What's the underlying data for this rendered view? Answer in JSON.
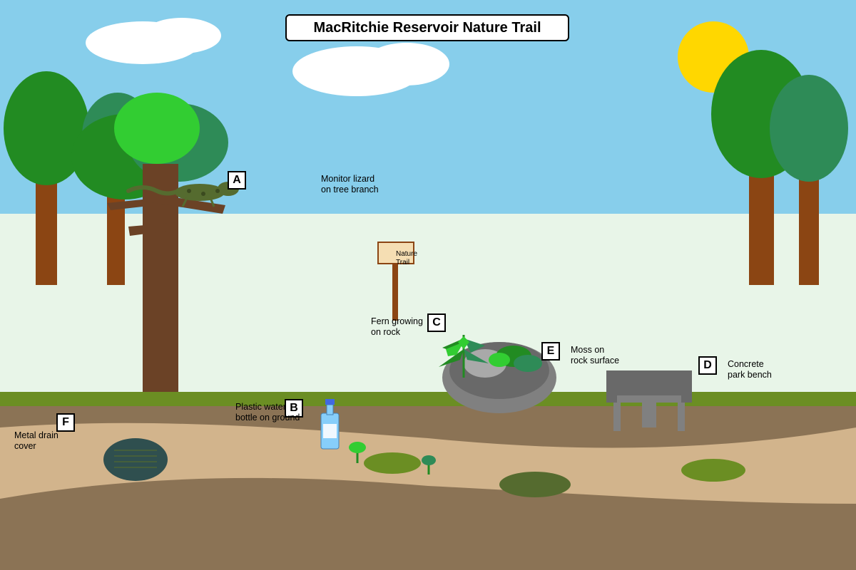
{
  "title": "MacRitchie Reservoir Nature Trail",
  "sign": {
    "line1": "Nature",
    "line2": "Trail"
  },
  "markers": [
    {
      "id": "A",
      "line1": "Monitor lizard",
      "line2": "on tree branch"
    },
    {
      "id": "B",
      "line1": "Plastic water",
      "line2": "bottle on ground"
    },
    {
      "id": "C",
      "line1": "Fern growing",
      "line2": "on rock"
    },
    {
      "id": "D",
      "line1": "Concrete",
      "line2": "park bench"
    },
    {
      "id": "E",
      "line1": "Moss on",
      "line2": "rock surface"
    },
    {
      "id": "F",
      "line1": "Metal drain",
      "line2": "cover"
    }
  ],
  "colors": {
    "sky": "#87CEEB",
    "haze": "#E8F5E8",
    "ground": "#8B7355",
    "path": "#D2B48C",
    "grass": "#6B8E23",
    "sun": "#FFD700",
    "trunk": "#8B4513"
  }
}
